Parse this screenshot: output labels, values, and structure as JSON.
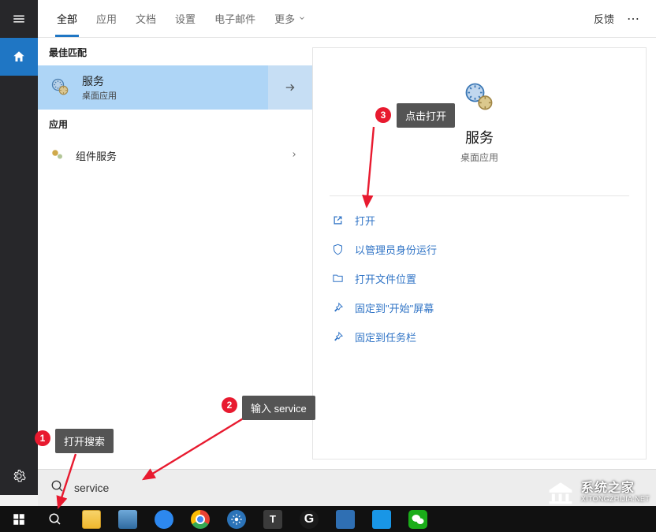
{
  "tabs": {
    "all": "全部",
    "apps": "应用",
    "docs": "文档",
    "settings": "设置",
    "email": "电子邮件",
    "more": "更多",
    "feedback": "反馈"
  },
  "results": {
    "best_match_header": "最佳匹配",
    "best": {
      "title": "服务",
      "subtitle": "桌面应用"
    },
    "apps_header": "应用",
    "app1": "组件服务"
  },
  "preview": {
    "title": "服务",
    "subtitle": "桌面应用",
    "actions": {
      "open": "打开",
      "admin": "以管理员身份运行",
      "location": "打开文件位置",
      "pin_start": "固定到\"开始\"屏幕",
      "pin_taskbar": "固定到任务栏"
    }
  },
  "search": {
    "value": "service"
  },
  "annotations": {
    "a1": {
      "num": "1",
      "text": "打开搜索"
    },
    "a2": {
      "num": "2",
      "text": "输入 service"
    },
    "a3": {
      "num": "3",
      "text": "点击打开"
    }
  },
  "watermark": {
    "cn": "系统之家",
    "en": "XITONGZHIJIA.NET"
  }
}
